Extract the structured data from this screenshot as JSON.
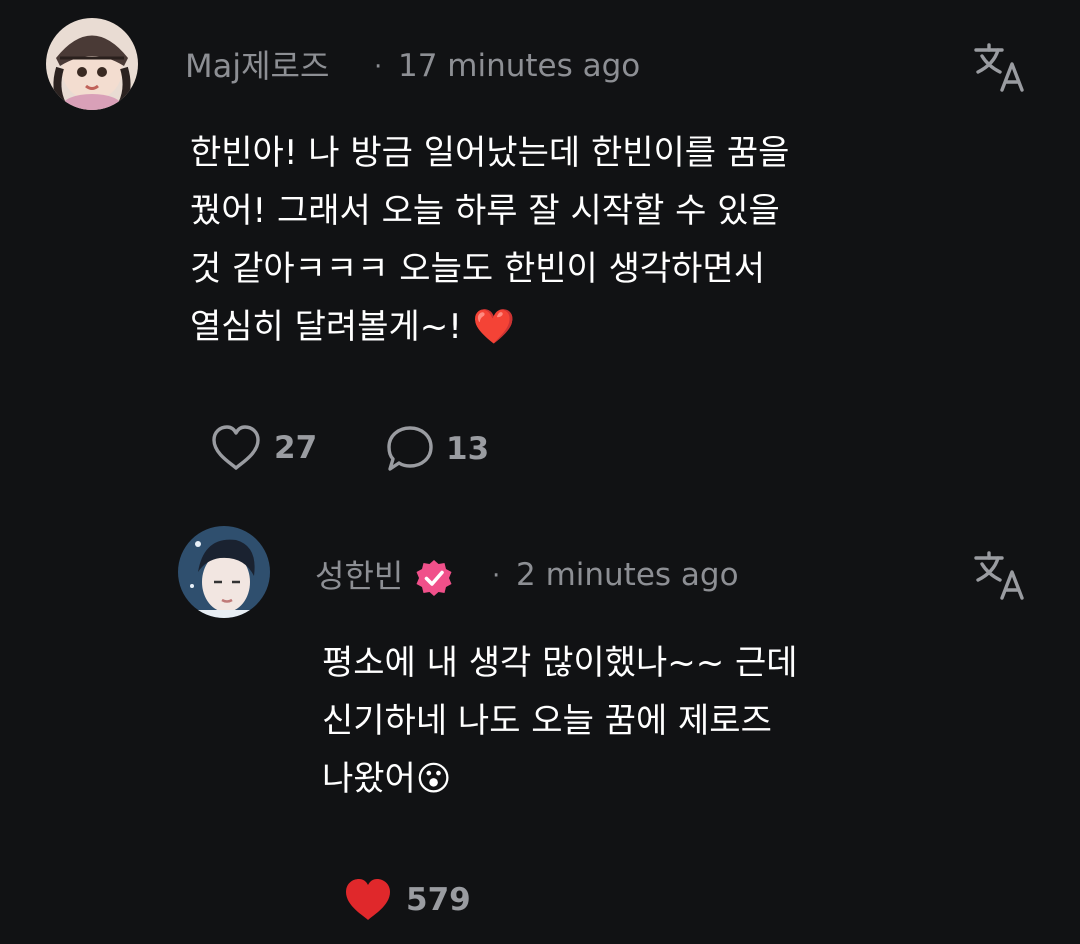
{
  "comment": {
    "author": "Maj제로즈",
    "separator": "·",
    "time": "17 minutes ago",
    "avatar_icon": "user-avatar-icon",
    "text": "한빈아! 나 방금 일어났는데 한빈이를 꿈을\n꿨어! 그래서 오늘 하루 잘 시작할 수 있을\n것 같아ㅋㅋㅋ 오늘도 한빈이 생각하면서\n열심히 달려볼게~! ❤️",
    "likes": "27",
    "replies": "13",
    "translate_icon": "translate-icon"
  },
  "reply": {
    "author": "성한빈",
    "verified_icon": "verified-badge-icon",
    "separator": "·",
    "time": "2 minutes ago",
    "text": "평소에 내 생각 많이했나~~ 근데\n신기하네 나도 오늘 꿈에 제로즈\n나왔어😮",
    "likes": "579",
    "translate_icon": "translate-icon"
  },
  "colors": {
    "background": "#111214",
    "muted_text": "#8d8f94",
    "heart_liked": "#e0282b",
    "verified_badge": "#f0508a"
  }
}
